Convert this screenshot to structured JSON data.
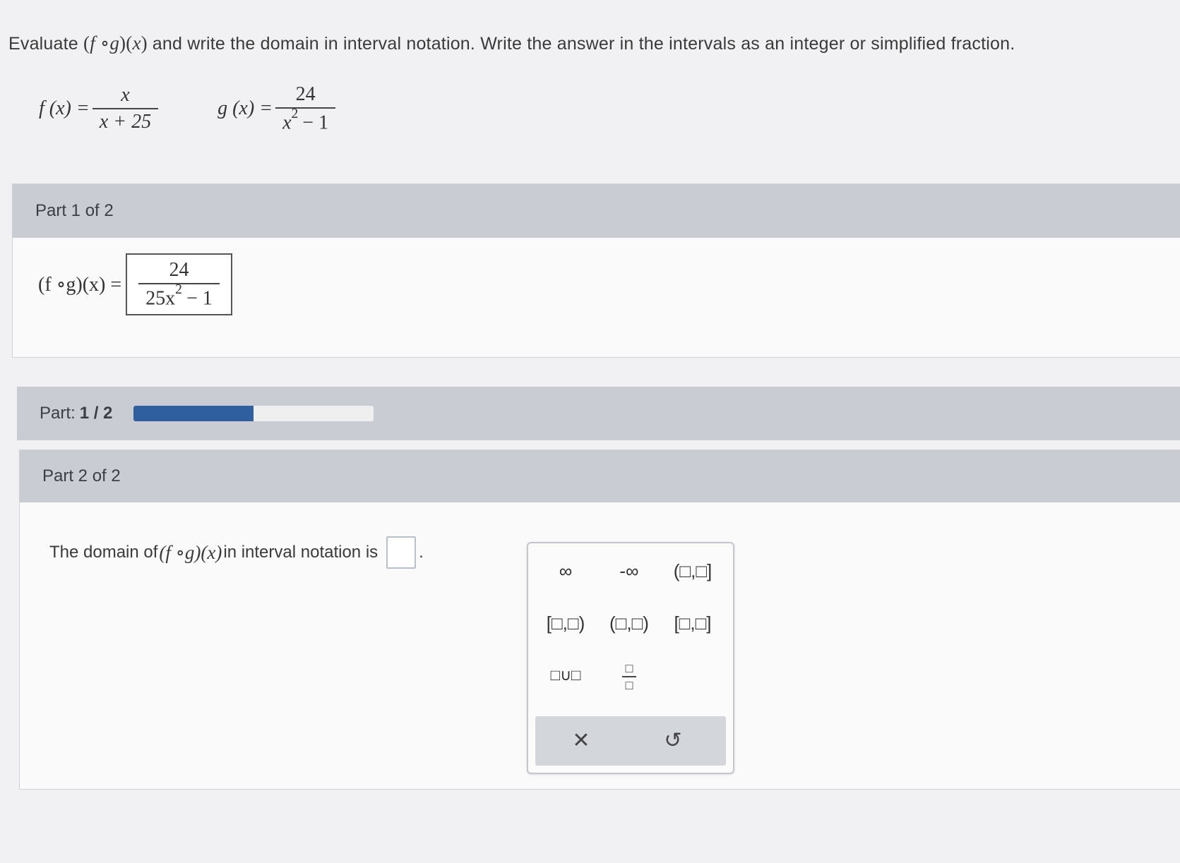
{
  "question": {
    "lead": "Evaluate",
    "expr_open": "(",
    "expr_f": "f",
    "expr_circ": " ∘",
    "expr_g": "g",
    "expr_close": ")(",
    "expr_x": "x",
    "expr_end": ")",
    "rest": " and write the domain in interval notation. Write the answer in the intervals as an integer or simplified fraction."
  },
  "definitions": {
    "f_lhs": "f (x) =",
    "f_num": "x",
    "f_den": "x + 25",
    "g_lhs": "g (x) =",
    "g_num": "24",
    "g_den_base": "x",
    "g_den_exp": "2",
    "g_den_rest": "− 1"
  },
  "part1": {
    "header": "Part 1 of 2",
    "lhs": "(f ∘g)(x) =",
    "answer_num": "24",
    "answer_den_base": "25x",
    "answer_den_exp": "2",
    "answer_den_rest": "− 1"
  },
  "progress": {
    "label": "Part:",
    "value": "1 / 2",
    "fraction": 0.5
  },
  "part2": {
    "header": "Part 2 of 2",
    "prompt_start": "The domain of ",
    "prompt_expr": "(f ∘g)(x)",
    "prompt_end": " in interval notation is",
    "period": "."
  },
  "palette": {
    "buttons": [
      {
        "label": "∞",
        "icon": "infinity-icon"
      },
      {
        "label": "-∞",
        "icon": "negative-infinity-icon"
      },
      {
        "label": "(□,□]",
        "icon": "open-closed-interval-icon"
      },
      {
        "label": "[□,□)",
        "icon": "closed-open-interval-icon"
      },
      {
        "label": "(□,□)",
        "icon": "open-interval-icon"
      },
      {
        "label": "[□,□]",
        "icon": "closed-interval-icon"
      },
      {
        "label": "□∪□",
        "icon": "union-icon"
      }
    ],
    "fraction_top": "□",
    "fraction_bottom": "□",
    "clear_label": "✕",
    "undo_label": "↺"
  }
}
